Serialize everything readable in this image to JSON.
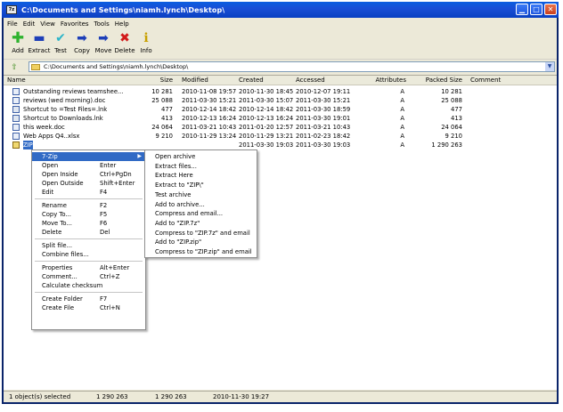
{
  "window": {
    "title": "C:\\Documents and Settings\\niamh.lynch\\Desktop\\",
    "app_icon_text": "7z"
  },
  "menubar": [
    "File",
    "Edit",
    "View",
    "Favorites",
    "Tools",
    "Help"
  ],
  "toolbar": [
    {
      "label": "Add",
      "icon": "plus-icon",
      "glyph": "✚"
    },
    {
      "label": "Extract",
      "icon": "minus-icon",
      "glyph": "▬"
    },
    {
      "label": "Test",
      "icon": "check-icon",
      "glyph": "✔"
    },
    {
      "label": "Copy",
      "icon": "copy-arrow-icon",
      "glyph": "➡"
    },
    {
      "label": "Move",
      "icon": "move-arrow-icon",
      "glyph": "➡"
    },
    {
      "label": "Delete",
      "icon": "delete-x-icon",
      "glyph": "✖"
    },
    {
      "label": "Info",
      "icon": "info-icon",
      "glyph": "ℹ"
    }
  ],
  "address": {
    "path": "C:\\Documents and Settings\\niamh.lynch\\Desktop\\"
  },
  "columns": [
    "Name",
    "Size",
    "Modified",
    "Created",
    "Accessed",
    "Attributes",
    "Packed Size",
    "Comment"
  ],
  "files": [
    {
      "name": "Outstanding reviews teamshee...",
      "size": "10 281",
      "modified": "2010-11-08 19:57",
      "created": "2010-11-30 18:45",
      "accessed": "2010-12-07 19:11",
      "attr": "A",
      "packed": "10 281",
      "type": "doc"
    },
    {
      "name": "reviews (wed morning).doc",
      "size": "25 088",
      "modified": "2011-03-30 15:21",
      "created": "2011-03-30 15:07",
      "accessed": "2011-03-30 15:21",
      "attr": "A",
      "packed": "25 088",
      "type": "doc"
    },
    {
      "name": "Shortcut to =Test Files=.lnk",
      "size": "477",
      "modified": "2010-12-14 18:42",
      "created": "2010-12-14 18:42",
      "accessed": "2011-03-30 18:59",
      "attr": "A",
      "packed": "477",
      "type": "lnk"
    },
    {
      "name": "Shortcut to Downloads.lnk",
      "size": "413",
      "modified": "2010-12-13 16:24",
      "created": "2010-12-13 16:24",
      "accessed": "2011-03-30 19:01",
      "attr": "A",
      "packed": "413",
      "type": "lnk"
    },
    {
      "name": "this week.doc",
      "size": "24 064",
      "modified": "2011-03-21 10:43",
      "created": "2011-01-20 12:57",
      "accessed": "2011-03-21 10:43",
      "attr": "A",
      "packed": "24 064",
      "type": "doc"
    },
    {
      "name": "Web Apps Q4..xlsx",
      "size": "9 210",
      "modified": "2010-11-29 13:24",
      "created": "2010-11-29 13:21",
      "accessed": "2011-02-23 18:42",
      "attr": "A",
      "packed": "9 210",
      "type": "doc"
    },
    {
      "name": "ZIP",
      "size": "",
      "modified": "",
      "created": "2011-03-30 19:03",
      "accessed": "2011-03-30 19:03",
      "attr": "A",
      "packed": "1 290 263",
      "type": "zip",
      "selected": true
    }
  ],
  "context_menu": {
    "items": [
      {
        "label": "7-Zip",
        "shortcut": "",
        "submenu": true,
        "highlighted": true
      },
      {
        "label": "Open",
        "shortcut": "Enter"
      },
      {
        "label": "Open Inside",
        "shortcut": "Ctrl+PgDn"
      },
      {
        "label": "Open Outside",
        "shortcut": "Shift+Enter"
      },
      {
        "label": "Edit",
        "shortcut": "F4"
      },
      {
        "sep": true
      },
      {
        "label": "Rename",
        "shortcut": "F2"
      },
      {
        "label": "Copy To...",
        "shortcut": "F5"
      },
      {
        "label": "Move To...",
        "shortcut": "F6"
      },
      {
        "label": "Delete",
        "shortcut": "Del"
      },
      {
        "sep": true
      },
      {
        "label": "Split file...",
        "shortcut": ""
      },
      {
        "label": "Combine files...",
        "shortcut": ""
      },
      {
        "sep": true
      },
      {
        "label": "Properties",
        "shortcut": "Alt+Enter"
      },
      {
        "label": "Comment...",
        "shortcut": "Ctrl+Z"
      },
      {
        "label": "Calculate checksum",
        "shortcut": ""
      },
      {
        "sep": true
      },
      {
        "label": "Create Folder",
        "shortcut": "F7"
      },
      {
        "label": "Create File",
        "shortcut": "Ctrl+N"
      }
    ]
  },
  "submenu": {
    "items": [
      "Open archive",
      "Extract files...",
      "Extract Here",
      "Extract to \"ZIP\\\"",
      "Test archive",
      "Add to archive...",
      "Compress and email...",
      "Add to \"ZIP.7z\"",
      "Compress to \"ZIP.7z\" and email",
      "Add to \"ZIP.zip\"",
      "Compress to \"ZIP.zip\" and email"
    ]
  },
  "status": {
    "selected": "1 object(s) selected",
    "size": "1 290 263",
    "packed": "1 290 263",
    "date": "2010-11-30 19:27"
  },
  "colors": {
    "titlebar": "#0a5ee0",
    "selection": "#316ac5",
    "chrome": "#ece9d8"
  }
}
